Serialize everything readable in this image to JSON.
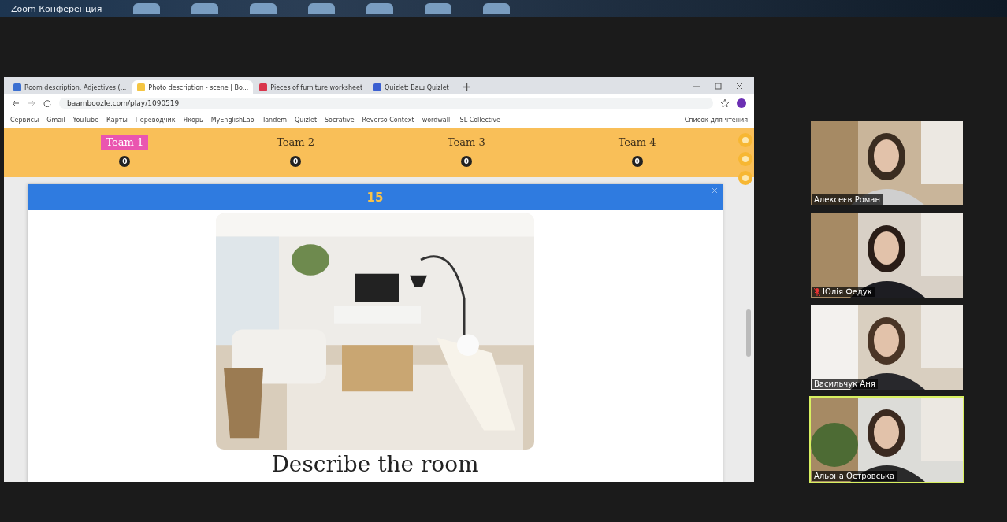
{
  "window": {
    "title": "Zoom Конференция"
  },
  "browser": {
    "tabs": [
      {
        "label": "Room description. Adjectives (...",
        "selected": false
      },
      {
        "label": "Photo description - scene | Bo...",
        "selected": true
      },
      {
        "label": "Pieces of furniture worksheet",
        "selected": false
      },
      {
        "label": "Quizlet: Ваш Quizlet",
        "selected": false
      }
    ],
    "address": "baamboozle.com/play/1090519",
    "bookmarks": [
      "Сервисы",
      "Gmail",
      "YouTube",
      "Карты",
      "Переводчик",
      "Якорь",
      "MyEnglishLab",
      "Tandem",
      "Quizlet",
      "Socrative",
      "Reverso Context",
      "wordwall",
      "ISL Collective"
    ],
    "reading_list": "Список для чтения"
  },
  "game": {
    "teams": [
      {
        "name": "Team 1",
        "score": "0",
        "selected": true
      },
      {
        "name": "Team 2",
        "score": "0",
        "selected": false
      },
      {
        "name": "Team 3",
        "score": "0",
        "selected": false
      },
      {
        "name": "Team 4",
        "score": "0",
        "selected": false
      }
    ],
    "timer": "15",
    "question": "Describe the room"
  },
  "participants": [
    {
      "name": "Алексеєв Роман",
      "active": false,
      "muted": false
    },
    {
      "name": "Юлія Федук",
      "active": false,
      "muted": true
    },
    {
      "name": "Васильчук Аня",
      "active": false,
      "muted": false
    },
    {
      "name": "Альона Островська",
      "active": true,
      "muted": false
    }
  ]
}
